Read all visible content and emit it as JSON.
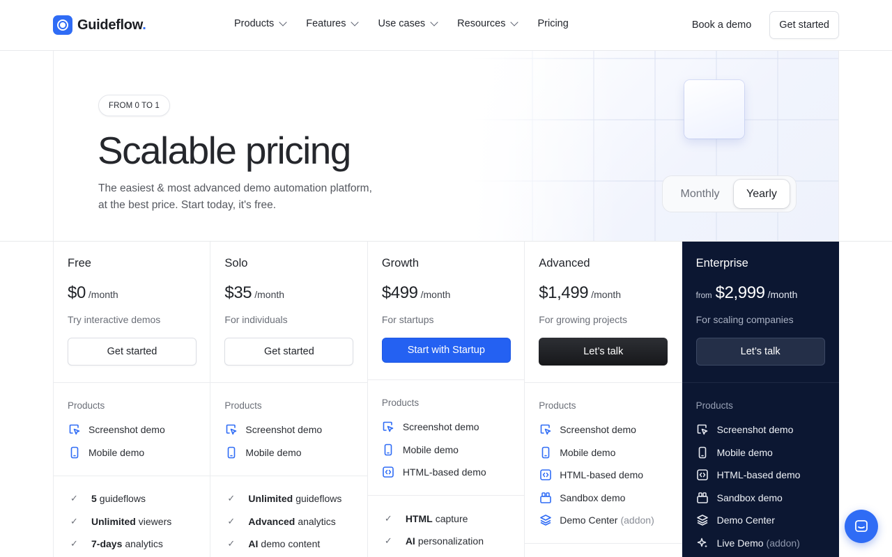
{
  "brand": {
    "name": "Guideflow",
    "dot": ".",
    "accent": "#2f6cf5"
  },
  "nav": {
    "menu": [
      {
        "label": "Products",
        "dropdown": true
      },
      {
        "label": "Features",
        "dropdown": true
      },
      {
        "label": "Use cases",
        "dropdown": true
      },
      {
        "label": "Resources",
        "dropdown": true
      },
      {
        "label": "Pricing",
        "dropdown": false
      }
    ],
    "book_demo": "Book a demo",
    "get_started": "Get started"
  },
  "hero": {
    "tag": "FROM 0 TO 1",
    "title": "Scalable pricing",
    "subtitle_line1": "The easiest & most advanced demo automation platform,",
    "subtitle_line2": "at the best price. Start today, it's free.",
    "toggle": {
      "monthly": "Monthly",
      "yearly": "Yearly",
      "selected": "Yearly"
    }
  },
  "plans": {
    "free": {
      "name": "Free",
      "price": "$0",
      "per": "/month",
      "desc": "Try interactive demos",
      "cta": "Get started",
      "products_label": "Products",
      "products": [
        "Screenshot demo",
        "Mobile demo"
      ],
      "features": [
        {
          "bold": "5",
          "text": "guideflows"
        },
        {
          "bold": "Unlimited",
          "text": "viewers"
        },
        {
          "bold": "7-days",
          "text": "analytics"
        }
      ]
    },
    "solo": {
      "name": "Solo",
      "price": "$35",
      "per": "/month",
      "desc": "For individuals",
      "cta": "Get started",
      "products_label": "Products",
      "products": [
        "Screenshot demo",
        "Mobile demo"
      ],
      "features": [
        {
          "bold": "Unlimited",
          "text": "guideflows"
        },
        {
          "bold": "Advanced",
          "text": "analytics"
        },
        {
          "bold": "AI",
          "text": "demo content"
        }
      ]
    },
    "growth": {
      "name": "Growth",
      "price": "$499",
      "per": "/month",
      "desc": "For startups",
      "cta": "Start with Startup",
      "products_label": "Products",
      "products": [
        "Screenshot demo",
        "Mobile demo",
        "HTML-based demo"
      ],
      "features": [
        {
          "bold": "HTML",
          "text": "capture"
        },
        {
          "bold": "AI",
          "text": "personalization"
        }
      ]
    },
    "advanced": {
      "name": "Advanced",
      "price": "$1,499",
      "per": "/month",
      "desc": "For growing projects",
      "cta": "Let’s talk",
      "products_label": "Products",
      "products": [
        "Screenshot demo",
        "Mobile demo",
        "HTML-based demo",
        "Sandbox demo",
        "Demo Center"
      ],
      "addon": "(addon)"
    },
    "enterprise": {
      "name": "Enterprise",
      "from": "from",
      "price": "$2,999",
      "per": "/month",
      "desc": "For scaling companies",
      "cta": "Let’s talk",
      "products_label": "Products",
      "products": [
        "Screenshot demo",
        "Mobile demo",
        "HTML-based demo",
        "Sandbox demo",
        "Demo Center",
        "Live Demo"
      ],
      "addon": "(addon)"
    }
  },
  "colors": {
    "cta_blue": "#2461f2",
    "enterprise_bg": "#0c1732",
    "icon_blue": "#2f6cf5"
  }
}
